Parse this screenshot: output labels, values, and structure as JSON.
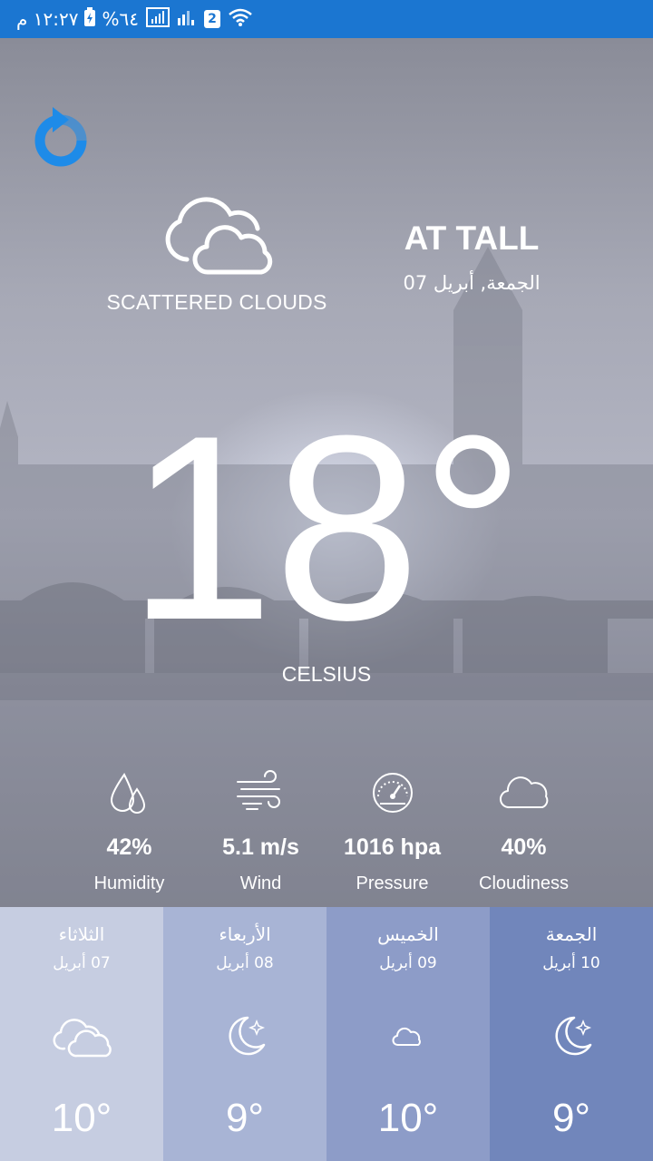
{
  "status_bar": {
    "time": "١٢:٢٧ م",
    "battery": "%٦٤",
    "sim_badge": "2",
    "background": "#1b76d1"
  },
  "header": {
    "refresh_icon": "refresh-icon",
    "accent": "#1e8be8"
  },
  "current": {
    "condition_icon": "scattered-clouds-icon",
    "condition": "SCATTERED CLOUDS",
    "city": "AT TALL",
    "date": "الجمعة, أبريل 07",
    "temperature": "18°",
    "unit": "CELSIUS"
  },
  "stats": [
    {
      "icon": "humidity-drop-icon",
      "value": "42%",
      "label": "Humidity"
    },
    {
      "icon": "wind-icon",
      "value": "5.1 m/s",
      "label": "Wind"
    },
    {
      "icon": "pressure-gauge-icon",
      "value": "1016 hpa",
      "label": "Pressure"
    },
    {
      "icon": "cloud-icon",
      "value": "40%",
      "label": "Cloudiness"
    }
  ],
  "forecast": [
    {
      "day": "الثلاثاء",
      "date": "07 أبريل",
      "icon": "clouds-icon",
      "temp": "10°",
      "bg": "#c6cde1"
    },
    {
      "day": "الأربعاء",
      "date": "08 أبريل",
      "icon": "moon-icon",
      "temp": "9°",
      "bg": "#a8b4d5"
    },
    {
      "day": "الخميس",
      "date": "09 أبريل",
      "icon": "small-cloud-icon",
      "temp": "10°",
      "bg": "#8d9cc8"
    },
    {
      "day": "الجمعة",
      "date": "10 أبريل",
      "icon": "moon-icon",
      "temp": "9°",
      "bg": "#7186bb"
    }
  ]
}
